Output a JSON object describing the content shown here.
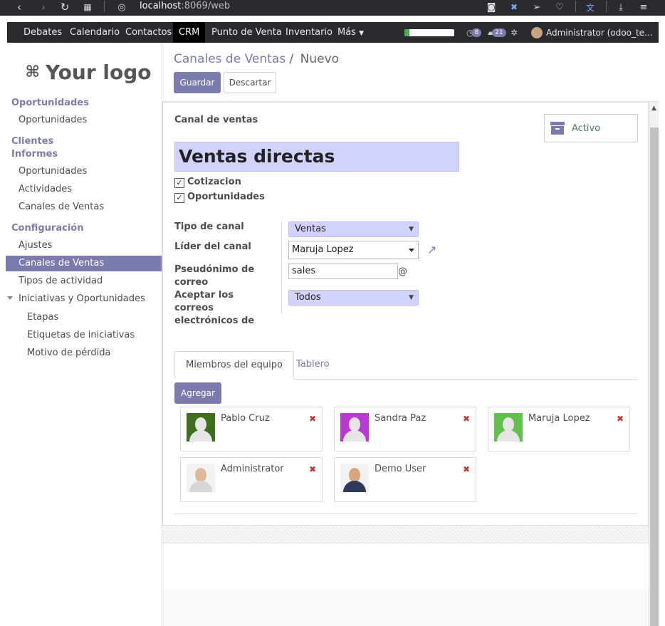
{
  "browser": {
    "url_host": "localhost",
    "url_rest": ":8069/web"
  },
  "nav": {
    "items": [
      "Debates",
      "Calendario",
      "Contactos",
      "CRM",
      "Punto de Venta",
      "Inventario",
      "Más"
    ],
    "active": "CRM",
    "activity_count": "8",
    "message_count": "21",
    "user": "Administrator (odoo_te…",
    "progress": 0.1
  },
  "sidebar": {
    "logo_text": "Your logo",
    "sections": [
      {
        "heading": "Oportunidades",
        "items": [
          "Oportunidades"
        ]
      },
      {
        "heading": "Clientes",
        "items": []
      },
      {
        "heading": "Informes",
        "items": [
          "Oportunidades",
          "Actividades",
          "Canales de Ventas"
        ]
      },
      {
        "heading": "Configuración",
        "items": [
          "Ajustes",
          "Canales de Ventas",
          "Tipos de actividad",
          "Iniciativas y Oportunidades",
          "Etapas",
          "Etiquetas de iniciativas",
          "Motivo de pérdida"
        ]
      }
    ],
    "active_item": "Canales de Ventas"
  },
  "breadcrumb": {
    "parent": "Canales de Ventas",
    "separator": "/",
    "current": "Nuevo"
  },
  "buttons": {
    "save": "Guardar",
    "discard": "Descartar"
  },
  "form": {
    "caption": "Canal de ventas",
    "name": "Ventas directas",
    "archive_label": "Activo",
    "checks": [
      {
        "label": "Cotizacion",
        "checked": true
      },
      {
        "label": "Oportunidades",
        "checked": true
      }
    ],
    "fields": {
      "type_label": "Tipo de canal",
      "type_value": "Ventas",
      "leader_label": "Líder del canal",
      "leader_value": "Maruja Lopez",
      "alias_label": "Pseudónimo de correo",
      "alias_value": "sales",
      "alias_suffix": "@",
      "accept_label": "Aceptar los correos electrónicos de",
      "accept_value": "Todos"
    },
    "tabs": [
      "Miembros del equipo",
      "Tablero"
    ],
    "add_label": "Agregar",
    "members": [
      {
        "name": "Pablo Cruz",
        "color": "#3f6e1f"
      },
      {
        "name": "Sandra Paz",
        "color": "#b73bcf"
      },
      {
        "name": "Maruja Lopez",
        "color": "#63c04f"
      },
      {
        "name": "Administrator",
        "color": "#f2f2f2"
      },
      {
        "name": "Demo User",
        "color": "#f2f2f2"
      }
    ]
  }
}
